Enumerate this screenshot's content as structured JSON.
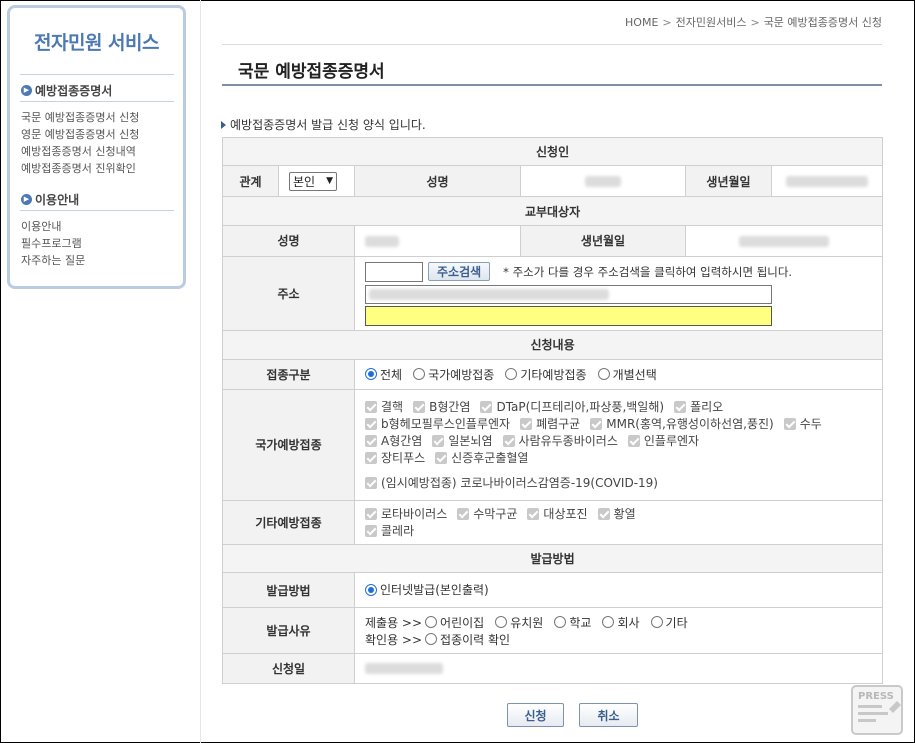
{
  "sidebar": {
    "title": "전자민원 서비스",
    "sections": [
      {
        "title": "예방접종증명서",
        "items": [
          "국문 예방접종증명서 신청",
          "영문 예방접종증명서 신청",
          "예방접종증명서 신청내역",
          "예방접종증명서 진위확인"
        ]
      },
      {
        "title": "이용안내",
        "items": [
          "이용안내",
          "필수프로그램",
          "자주하는 질문"
        ]
      }
    ]
  },
  "breadcrumb": [
    "HOME",
    "전자민원서비스",
    "국문 예방접종증명서 신청"
  ],
  "page_title": "국문 예방접종증명서",
  "intro": "예방접종증명서 발급 신청 양식 입니다.",
  "applicant": {
    "section": "신청인",
    "relation_label": "관계",
    "relation_value": "본인",
    "name_label": "성명",
    "dob_label": "생년월일"
  },
  "recipient": {
    "section": "교부대상자",
    "name_label": "성명",
    "dob_label": "생년월일",
    "address_label": "주소",
    "address_search_button": "주소검색",
    "address_note": "* 주소가 다를 경우 주소검색을 클릭하여 입력하시면 됩니다."
  },
  "content": {
    "section": "신청내용",
    "type_label": "접종구분",
    "type_options": [
      {
        "label": "전체",
        "selected": true
      },
      {
        "label": "국가예방접종",
        "selected": false
      },
      {
        "label": "기타예방접종",
        "selected": false
      },
      {
        "label": "개별선택",
        "selected": false
      }
    ],
    "national_label": "국가예방접종",
    "national_rows": [
      [
        "결핵",
        "B형간염",
        "DTaP(디프테리아,파상풍,백일해)",
        "폴리오"
      ],
      [
        "b형헤모필루스인플루엔자",
        "폐렴구균",
        "MMR(홍역,유행성이하선염,풍진)",
        "수두"
      ],
      [
        "A형간염",
        "일본뇌염",
        "사람유두종바이러스",
        "인플루엔자"
      ],
      [
        "장티푸스",
        "신증후군출혈열"
      ],
      [
        "(임시예방접종) 코로나바이러스감염증-19(COVID-19)"
      ]
    ],
    "other_label": "기타예방접종",
    "other_rows": [
      [
        "로타바이러스",
        "수막구균",
        "대상포진",
        "황열"
      ],
      [
        "콜레라"
      ]
    ]
  },
  "issue": {
    "section": "발급방법",
    "method_label": "발급방법",
    "method_option": "인터넷발급(본인출력)",
    "reason_label": "발급사유",
    "submit_prefix": "제출용 >>",
    "submit_options": [
      "어린이집",
      "유치원",
      "학교",
      "회사",
      "기타"
    ],
    "confirm_prefix": "확인용 >>",
    "confirm_options": [
      "접종이력 확인"
    ],
    "date_label": "신청일"
  },
  "buttons": {
    "apply": "신청",
    "cancel": "취소"
  },
  "badge": "PRESS"
}
